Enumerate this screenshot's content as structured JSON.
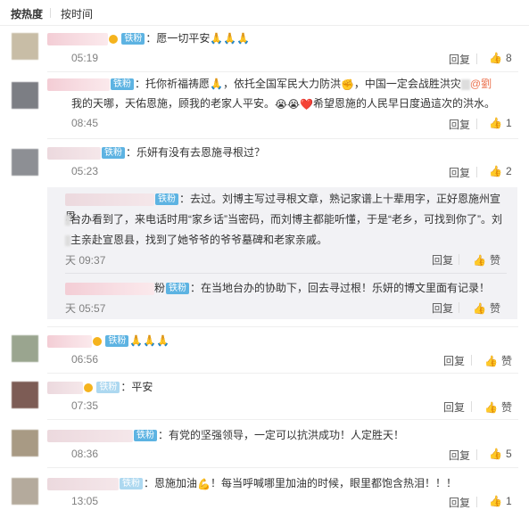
{
  "tabs": {
    "hot": "按热度",
    "time": "按时间"
  },
  "badge": "铁粉",
  "actions": {
    "reply": "回复",
    "like_text": "赞"
  },
  "comments": [
    {
      "text": "：愿一切平安🙏🙏🙏",
      "time": "05:19",
      "likes": "8"
    },
    {
      "text1": "：托你祈福祷愿🙏，依托全国军民大力防洪",
      "text1b": "，中国一定会战胜洪灾",
      "mention": "@劉",
      "text2": "我的天哪，天佑恩施，顾我的老家人平安。",
      "text2b": "希望恩施的人民早日度過這次的洪水。",
      "time": "08:45",
      "likes": "1"
    },
    {
      "text": "：乐妍有没有去恩施寻根过？",
      "time": "05:23",
      "likes": "2",
      "replies": [
        {
          "text1": "：去过。刘博主写过寻根文章，熟记家谱上十辈用字，正好恩施州宣恩",
          "text2": "台办看到了，来电话时用“家乡话”当密码，而刘博主都能听懂，于是“老乡，可找到你了”。刘",
          "text3": "主亲赴宣恩县，找到了她爷爷的爷爷墓碑和老家亲戚。",
          "time": "天 09:37"
        },
        {
          "name_text": "粉",
          "text": "：在当地台办的协助下，回去寻过根！乐妍的博文里面有记录！",
          "time": "天 05:57"
        }
      ]
    },
    {
      "text": "🙏🙏🙏",
      "time": "06:56"
    },
    {
      "text": "：平安",
      "time": "07:35"
    },
    {
      "text": "：有党的坚强领导，一定可以抗洪成功！人定胜天！",
      "time": "08:36",
      "likes": "5"
    },
    {
      "text1": "：恩施加油",
      "text2": "！每当呼喊哪里加油的时候，眼里都饱含热泪！！！",
      "time": "13:05",
      "likes": "1"
    }
  ]
}
